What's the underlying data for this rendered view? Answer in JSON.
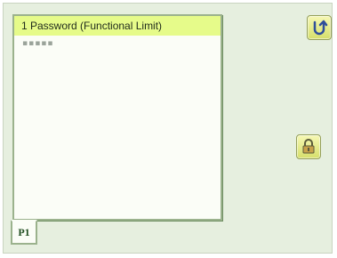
{
  "panel": {
    "title": "1 Password (Functional Limit)",
    "password_mask": "▪▪▪▪▪"
  },
  "page_tab": {
    "label": "P1"
  },
  "icons": {
    "back": "back-arrow-icon",
    "lock": "lock-icon"
  },
  "colors": {
    "background": "#e6efdf",
    "title_highlight": "#e6fb8a",
    "panel": "#fbfdf7",
    "button": "#e6ee8a",
    "border": "#9bb28d"
  }
}
